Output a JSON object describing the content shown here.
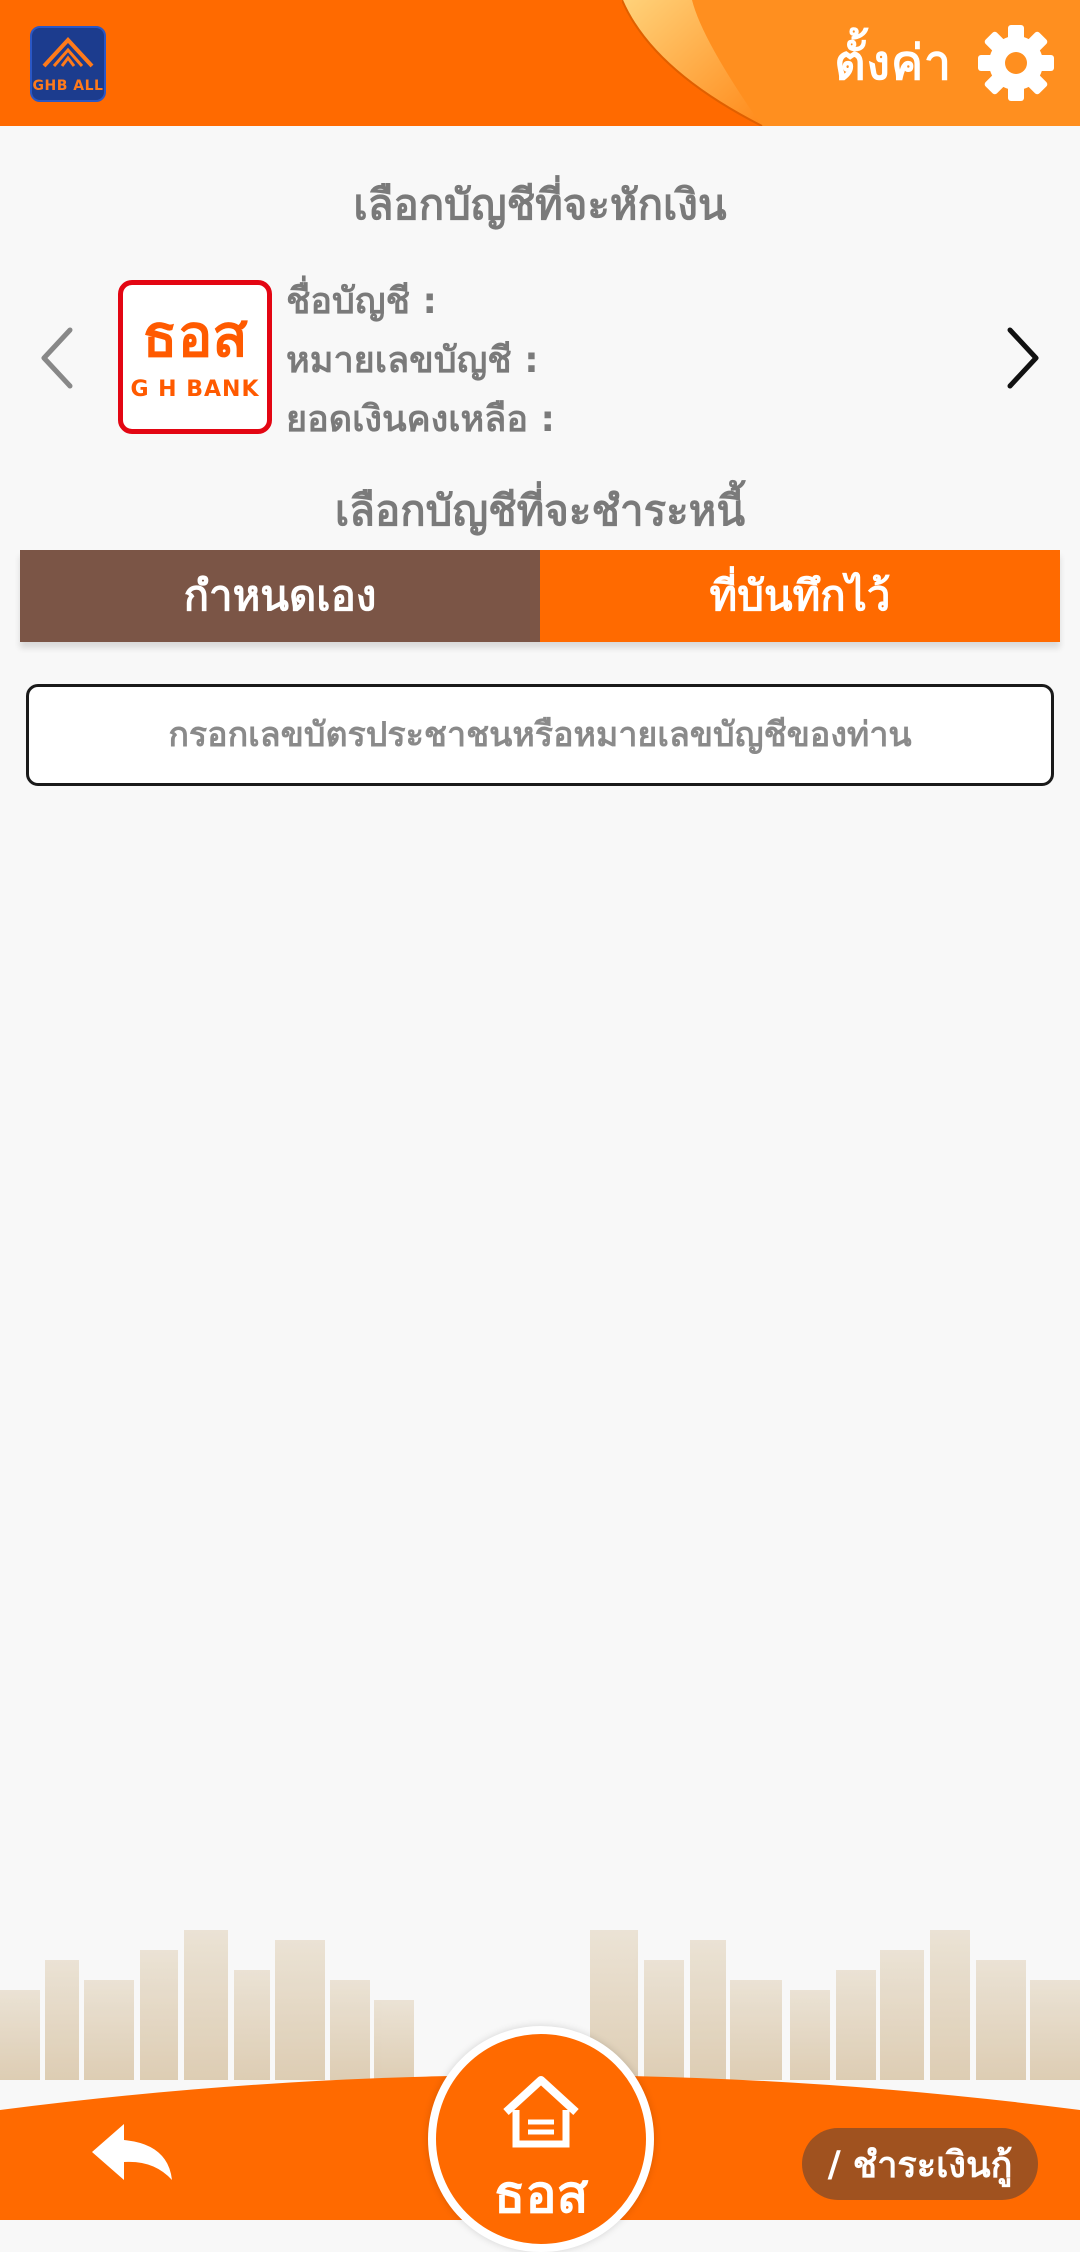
{
  "header": {
    "logo_text": "GHB ALL",
    "settings_label": "ตั้งค่า",
    "icons": [
      "ghb-all-logo",
      "gear-icon"
    ]
  },
  "debit": {
    "title": "เลือกบัญชีที่จะหักเงิน",
    "bank_logo": {
      "main": "ธอส",
      "sub": "G H BANK"
    },
    "account_name_label": "ชื่อบัญชี :",
    "account_number_label": "หมายเลขบัญชี :",
    "balance_label": "ยอดเงินคงเหลือ :",
    "icons": [
      "chevron-left-icon",
      "chevron-right-icon"
    ]
  },
  "credit": {
    "title": "เลือกบัญชีที่จะชำระหนี้",
    "tabs": [
      {
        "label": "กำหนดเอง",
        "color": "#7b5546"
      },
      {
        "label": "ที่บันทึกไว้",
        "color": "#ff6a00"
      }
    ],
    "search_placeholder": "กรอกเลขบัตรประชาชนหรือหมายเลขบัญชีของท่าน"
  },
  "footer": {
    "home_label": "ธอส",
    "breadcrumb_sep": "/",
    "breadcrumb_label": "ชำระเงินกู้",
    "icons": [
      "back-arrow-icon",
      "home-icon"
    ]
  },
  "colors": {
    "accent": "#ff6a00",
    "brown": "#7b5546",
    "red": "#e30613",
    "text_gray": "#7a7a7a"
  }
}
